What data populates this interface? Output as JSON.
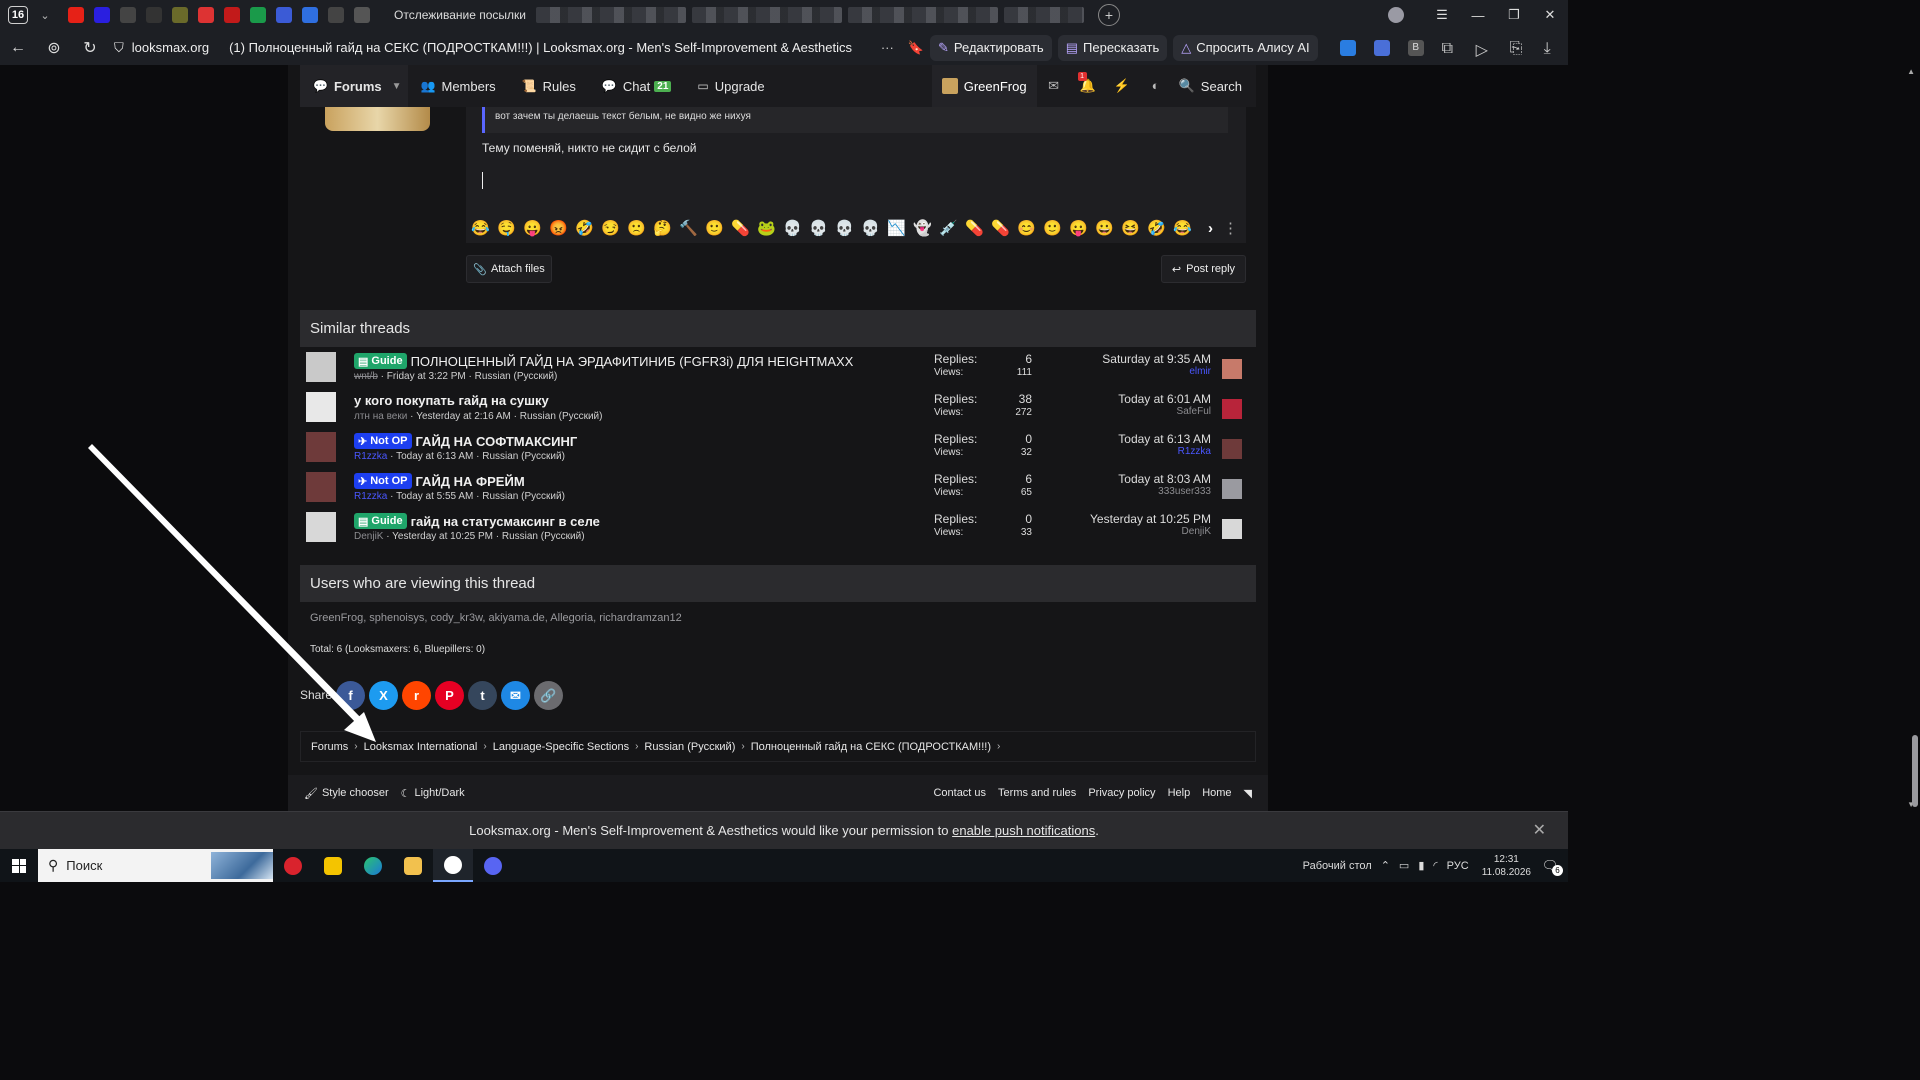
{
  "browser": {
    "tab_count": "16",
    "active_tab_title": "Отслеживание посылки",
    "url_domain": "looksmax.org",
    "page_title": "(1) Полноценный гайд на СЕКС (ПОДРОСТКАМ!!!) | Looksmax.org - Men's Self-Improvement & Aesthetics",
    "actions": {
      "edit": "Редактировать",
      "retell": "Пересказать",
      "ask_alice": "Спросить Алису AI"
    },
    "ext_badge": "В"
  },
  "site_nav": {
    "forums": "Forums",
    "members": "Members",
    "rules": "Rules",
    "chat": "Chat",
    "chat_badge": "21",
    "upgrade": "Upgrade",
    "username": "GreenFrog",
    "alerts_badge": "1",
    "search": "Search"
  },
  "editor": {
    "quote_text": "вот зачем ты делаешь текст белым, не видно же нихуя",
    "body_text": "Тему поменяй, никто не сидит с белой",
    "emojis": [
      "😂",
      "🤤",
      "😛",
      "😡",
      "🤣",
      "😏",
      "🙁",
      "🤔",
      "🔨",
      "🙂",
      "💊",
      "🐸",
      "💀",
      "💀",
      "💀",
      "💀",
      "📉",
      "👻",
      "💉",
      "💊",
      "💊",
      "😊",
      "🙂",
      "😛",
      "😀",
      "😆",
      "🤣",
      "😂"
    ],
    "attach_label": "Attach files",
    "post_reply_label": "Post reply"
  },
  "similar_threads": {
    "heading": "Similar threads",
    "replies_label": "Replies:",
    "views_label": "Views:",
    "items": [
      {
        "prefix": "Guide",
        "prefix_type": "guide",
        "title": "ПОЛНОЦЕННЫЙ ГАЙД НА ЭРДАФИТИНИБ (FGFR3i) ДЛЯ HEIGHTMAXX",
        "bold": false,
        "author": "wnt/b",
        "author_style": "strike",
        "meta": " · Friday at 3:22 PM · Russian (Русский)",
        "replies": "6",
        "views": "111",
        "last_date": "Saturday at 9:35 AM",
        "last_user": "elmir",
        "last_user_style": "blue",
        "avatar_color": "#c9c9c9",
        "last_avatar_color": "#c77a6a"
      },
      {
        "prefix": "",
        "prefix_type": "",
        "title": "у кого покупать гайд на сушку",
        "bold": true,
        "author": "лтн на веки",
        "author_style": "",
        "meta": " · Yesterday at 2:16 AM · Russian (Русский)",
        "replies": "38",
        "views": "272",
        "last_date": "Today at 6:01 AM",
        "last_user": "SafeFul",
        "last_user_style": "",
        "avatar_color": "#e8e8e8",
        "last_avatar_color": "#b8243a"
      },
      {
        "prefix": "Not OP",
        "prefix_type": "notop",
        "title": "ГАЙД НА СОФТМАКСИНГ",
        "bold": true,
        "author": "R1zzka",
        "author_style": "blue",
        "meta": " · Today at 6:13 AM · Russian (Русский)",
        "replies": "0",
        "views": "32",
        "last_date": "Today at 6:13 AM",
        "last_user": "R1zzka",
        "last_user_style": "blue",
        "avatar_color": "#6e3a3a",
        "last_avatar_color": "#6e3a3a"
      },
      {
        "prefix": "Not OP",
        "prefix_type": "notop",
        "title": "ГАЙД НА ФРЕЙМ",
        "bold": true,
        "author": "R1zzka",
        "author_style": "blue",
        "meta": " · Today at 5:55 AM · Russian (Русский)",
        "replies": "6",
        "views": "65",
        "last_date": "Today at 8:03 AM",
        "last_user": "333user333",
        "last_user_style": "",
        "avatar_color": "#6e3a3a",
        "last_avatar_color": "#9a9aa0"
      },
      {
        "prefix": "Guide",
        "prefix_type": "guide",
        "title": "гайд на статусмаксинг в селе",
        "bold": true,
        "author": "DenjiK",
        "author_style": "",
        "meta": " · Yesterday at 10:25 PM · Russian (Русский)",
        "replies": "0",
        "views": "33",
        "last_date": "Yesterday at 10:25 PM",
        "last_user": "DenjiK",
        "last_user_style": "",
        "avatar_color": "#d8d8d8",
        "last_avatar_color": "#d8d8d8"
      }
    ]
  },
  "viewers": {
    "heading": "Users who are viewing this thread",
    "list": "GreenFrog, sphenoisys, cody_kr3w, akiyama.de, Allegoria, richardramzan12",
    "total": "Total: 6 (Looksmaxers: 6, Bluepillers: 0)"
  },
  "share": {
    "label": "Share:",
    "buttons": [
      {
        "name": "facebook",
        "glyph": "f",
        "color": "#3b5998"
      },
      {
        "name": "x",
        "glyph": "X",
        "color": "#1d9bf0"
      },
      {
        "name": "reddit",
        "glyph": "r",
        "color": "#ff4500"
      },
      {
        "name": "pinterest",
        "glyph": "P",
        "color": "#e60023"
      },
      {
        "name": "tumblr",
        "glyph": "t",
        "color": "#35465c"
      },
      {
        "name": "email",
        "glyph": "✉",
        "color": "#1e88e5"
      },
      {
        "name": "link",
        "glyph": "🔗",
        "color": "#6b6b6f"
      }
    ]
  },
  "breadcrumbs": [
    "Forums",
    "Looksmax International",
    "Language-Specific Sections",
    "Russian (Русский)",
    "Полноценный гайд на СЕКС (ПОДРОСТКАМ!!!)"
  ],
  "footer": {
    "style_chooser": "Style chooser",
    "light_dark": "Light/Dark",
    "links": [
      "Contact us",
      "Terms and rules",
      "Privacy policy",
      "Help",
      "Home"
    ]
  },
  "push_bar": {
    "text_before": "Looksmax.org - Men's Self-Improvement & Aesthetics would like your permission to ",
    "link": "enable push notifications",
    "text_after": "."
  },
  "taskbar": {
    "search_placeholder": "Поиск",
    "desktop_label": "Рабочий стол",
    "lang": "РУС",
    "time": "12:31",
    "date": "11.08.2026",
    "notif_count": "6"
  },
  "colors": {
    "accent_green": "#1fa56a",
    "accent_blue": "#1d3ff0",
    "page_bg": "#151517",
    "outer_bg": "#0b0b0d"
  }
}
